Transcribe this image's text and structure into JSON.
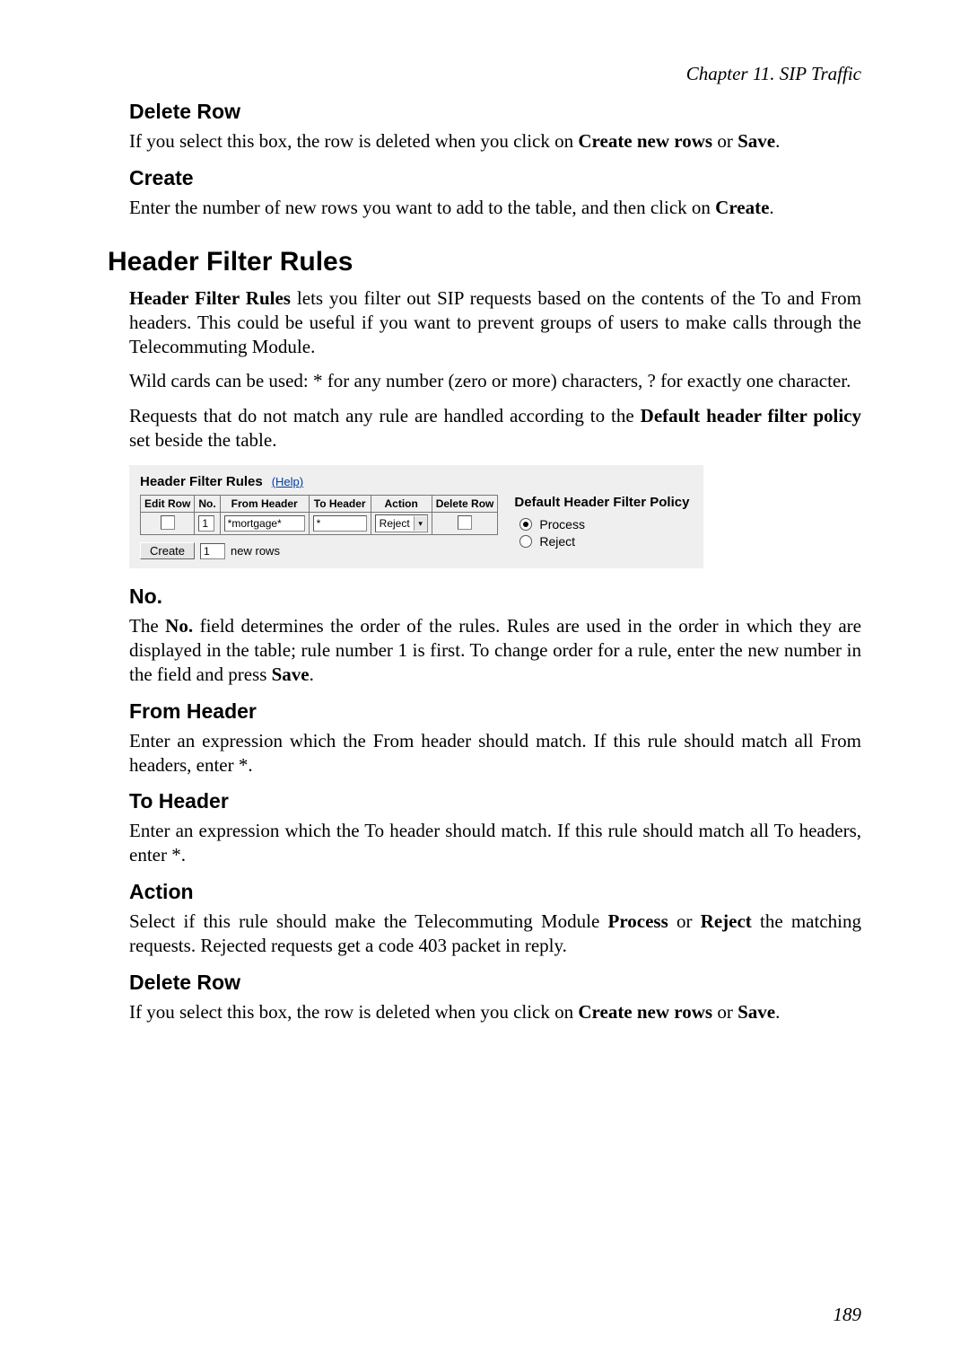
{
  "chapter_header": "Chapter 11. SIP Traffic",
  "sec_delete_row": {
    "title": "Delete Row",
    "p1_a": "If you select this box, the row is deleted when you click on ",
    "p1_b": "Create new rows",
    "p1_c": " or ",
    "p1_d": "Save",
    "p1_e": "."
  },
  "sec_create": {
    "title": "Create",
    "p1_a": "Enter the number of new rows you want to add to the table, and then click on ",
    "p1_b": "Create",
    "p1_c": "."
  },
  "hfr": {
    "title": "Header Filter Rules",
    "intro1_a": "Header Filter Rules",
    "intro1_b": " lets you filter out SIP requests based on the contents of the To and From headers. This could be useful if you want to prevent groups of users to make calls through the Telecommuting Module.",
    "intro2": "Wild cards can be used: * for any number (zero or more) characters, ? for exactly one character.",
    "intro3_a": "Requests that do not match any rule are handled according to the ",
    "intro3_b": "Default header filter policy",
    "intro3_c": " set beside the table."
  },
  "figure": {
    "title": "Header Filter Rules",
    "help": "(Help)",
    "cols": [
      "Edit Row",
      "No.",
      "From Header",
      "To Header",
      "Action",
      "Delete Row"
    ],
    "row1": {
      "no": "1",
      "from": "*mortgage*",
      "to": "*",
      "action": "Reject"
    },
    "create_btn": "Create",
    "create_count": "1",
    "create_suffix": "new rows",
    "policy_title": "Default Header Filter Policy",
    "policy_process": "Process",
    "policy_reject": "Reject"
  },
  "sec_no": {
    "title": "No.",
    "p1_a": "The ",
    "p1_b": "No.",
    "p1_c": " field determines the order of the rules. Rules are used in the order in which they are displayed in the table; rule number 1 is first. To change order for a rule, enter the new number in the field and press ",
    "p1_d": "Save",
    "p1_e": "."
  },
  "sec_from": {
    "title": "From Header",
    "p1": "Enter an expression which the From header should match. If this rule should match all From headers, enter *."
  },
  "sec_to": {
    "title": "To Header",
    "p1": "Enter an expression which the To header should match. If this rule should match all To headers, enter *."
  },
  "sec_action": {
    "title": "Action",
    "p1_a": "Select if this rule should make the Telecommuting Module ",
    "p1_b": "Process",
    "p1_c": " or ",
    "p1_d": "Reject",
    "p1_e": " the matching requests. Rejected requests get a code 403 packet in reply."
  },
  "sec_delete_row2": {
    "title": "Delete Row",
    "p1_a": "If you select this box, the row is deleted when you click on ",
    "p1_b": "Create new rows",
    "p1_c": " or ",
    "p1_d": "Save",
    "p1_e": "."
  },
  "page_number": "189"
}
